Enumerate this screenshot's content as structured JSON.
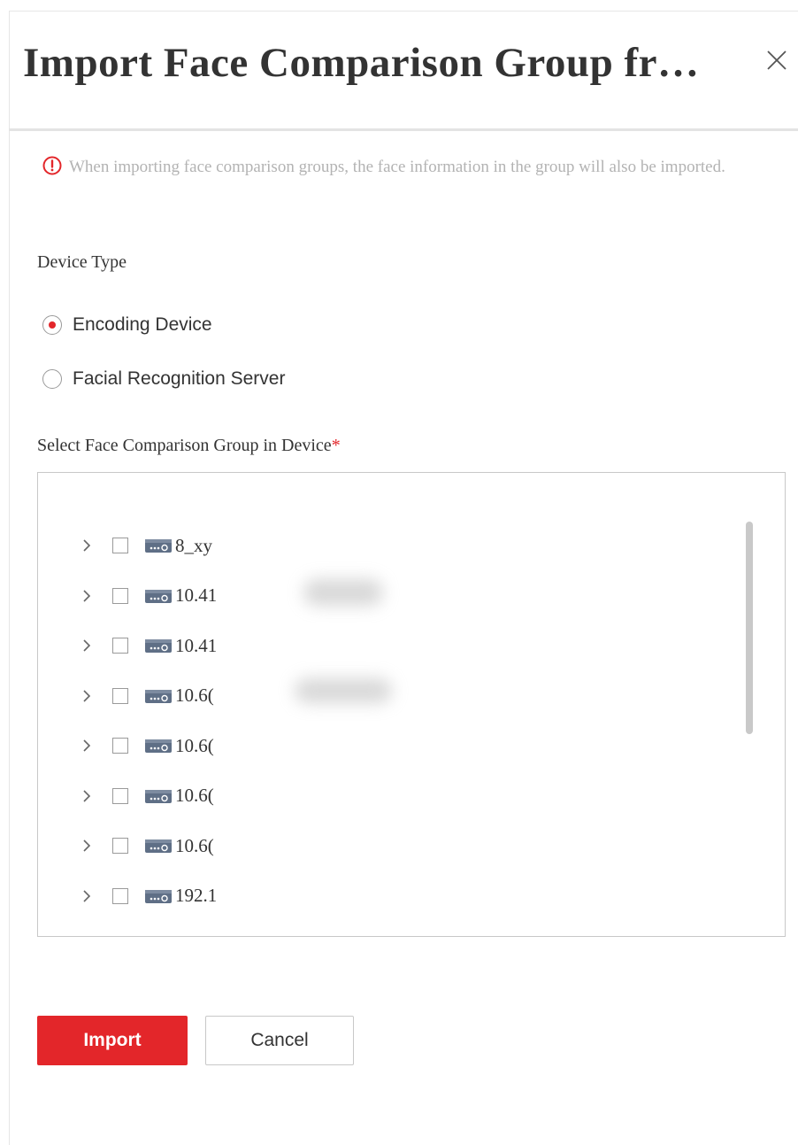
{
  "dialog": {
    "title": "Import Face Comparison Group fr…",
    "close_icon": "close-icon"
  },
  "notice": {
    "icon": "alert-circle-icon",
    "text": "When importing face comparison groups, the face information in the group will also be imported.",
    "icon_color": "#e3262a"
  },
  "device_type": {
    "label": "Device Type",
    "options": [
      {
        "label": "Encoding Device",
        "checked": true
      },
      {
        "label": "Facial Recognition Server",
        "checked": false
      }
    ]
  },
  "group_select": {
    "label": "Select Face Comparison Group in Device",
    "required_mark": "*",
    "nodes": [
      {
        "label": "8_xy"
      },
      {
        "label": "10.41"
      },
      {
        "label": "10.41"
      },
      {
        "label": "10.6("
      },
      {
        "label": "10.6("
      },
      {
        "label": "10.6("
      },
      {
        "label": "10.6("
      },
      {
        "label": "192.1"
      }
    ]
  },
  "buttons": {
    "import_label": "Import",
    "cancel_label": "Cancel"
  },
  "colors": {
    "accent": "#e3262a",
    "device_icon": "#5f6f86"
  }
}
